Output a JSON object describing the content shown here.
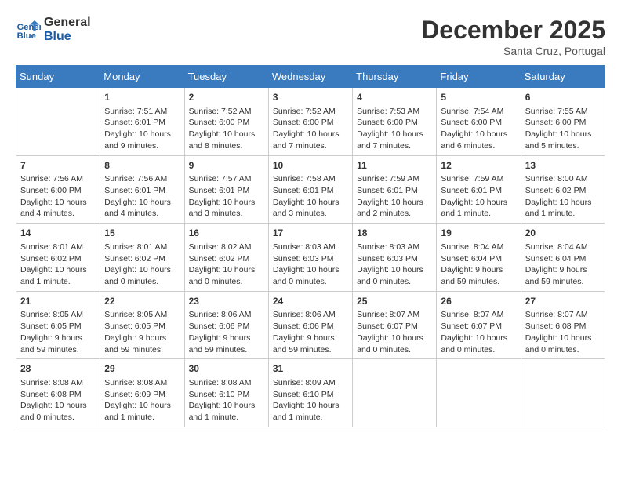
{
  "header": {
    "logo_line1": "General",
    "logo_line2": "Blue",
    "month_year": "December 2025",
    "location": "Santa Cruz, Portugal"
  },
  "days_of_week": [
    "Sunday",
    "Monday",
    "Tuesday",
    "Wednesday",
    "Thursday",
    "Friday",
    "Saturday"
  ],
  "weeks": [
    [
      {
        "day": "",
        "info": ""
      },
      {
        "day": "1",
        "info": "Sunrise: 7:51 AM\nSunset: 6:01 PM\nDaylight: 10 hours\nand 9 minutes."
      },
      {
        "day": "2",
        "info": "Sunrise: 7:52 AM\nSunset: 6:00 PM\nDaylight: 10 hours\nand 8 minutes."
      },
      {
        "day": "3",
        "info": "Sunrise: 7:52 AM\nSunset: 6:00 PM\nDaylight: 10 hours\nand 7 minutes."
      },
      {
        "day": "4",
        "info": "Sunrise: 7:53 AM\nSunset: 6:00 PM\nDaylight: 10 hours\nand 7 minutes."
      },
      {
        "day": "5",
        "info": "Sunrise: 7:54 AM\nSunset: 6:00 PM\nDaylight: 10 hours\nand 6 minutes."
      },
      {
        "day": "6",
        "info": "Sunrise: 7:55 AM\nSunset: 6:00 PM\nDaylight: 10 hours\nand 5 minutes."
      }
    ],
    [
      {
        "day": "7",
        "info": "Sunrise: 7:56 AM\nSunset: 6:00 PM\nDaylight: 10 hours\nand 4 minutes."
      },
      {
        "day": "8",
        "info": "Sunrise: 7:56 AM\nSunset: 6:01 PM\nDaylight: 10 hours\nand 4 minutes."
      },
      {
        "day": "9",
        "info": "Sunrise: 7:57 AM\nSunset: 6:01 PM\nDaylight: 10 hours\nand 3 minutes."
      },
      {
        "day": "10",
        "info": "Sunrise: 7:58 AM\nSunset: 6:01 PM\nDaylight: 10 hours\nand 3 minutes."
      },
      {
        "day": "11",
        "info": "Sunrise: 7:59 AM\nSunset: 6:01 PM\nDaylight: 10 hours\nand 2 minutes."
      },
      {
        "day": "12",
        "info": "Sunrise: 7:59 AM\nSunset: 6:01 PM\nDaylight: 10 hours\nand 1 minute."
      },
      {
        "day": "13",
        "info": "Sunrise: 8:00 AM\nSunset: 6:02 PM\nDaylight: 10 hours\nand 1 minute."
      }
    ],
    [
      {
        "day": "14",
        "info": "Sunrise: 8:01 AM\nSunset: 6:02 PM\nDaylight: 10 hours\nand 1 minute."
      },
      {
        "day": "15",
        "info": "Sunrise: 8:01 AM\nSunset: 6:02 PM\nDaylight: 10 hours\nand 0 minutes."
      },
      {
        "day": "16",
        "info": "Sunrise: 8:02 AM\nSunset: 6:02 PM\nDaylight: 10 hours\nand 0 minutes."
      },
      {
        "day": "17",
        "info": "Sunrise: 8:03 AM\nSunset: 6:03 PM\nDaylight: 10 hours\nand 0 minutes."
      },
      {
        "day": "18",
        "info": "Sunrise: 8:03 AM\nSunset: 6:03 PM\nDaylight: 10 hours\nand 0 minutes."
      },
      {
        "day": "19",
        "info": "Sunrise: 8:04 AM\nSunset: 6:04 PM\nDaylight: 9 hours\nand 59 minutes."
      },
      {
        "day": "20",
        "info": "Sunrise: 8:04 AM\nSunset: 6:04 PM\nDaylight: 9 hours\nand 59 minutes."
      }
    ],
    [
      {
        "day": "21",
        "info": "Sunrise: 8:05 AM\nSunset: 6:05 PM\nDaylight: 9 hours\nand 59 minutes."
      },
      {
        "day": "22",
        "info": "Sunrise: 8:05 AM\nSunset: 6:05 PM\nDaylight: 9 hours\nand 59 minutes."
      },
      {
        "day": "23",
        "info": "Sunrise: 8:06 AM\nSunset: 6:06 PM\nDaylight: 9 hours\nand 59 minutes."
      },
      {
        "day": "24",
        "info": "Sunrise: 8:06 AM\nSunset: 6:06 PM\nDaylight: 9 hours\nand 59 minutes."
      },
      {
        "day": "25",
        "info": "Sunrise: 8:07 AM\nSunset: 6:07 PM\nDaylight: 10 hours\nand 0 minutes."
      },
      {
        "day": "26",
        "info": "Sunrise: 8:07 AM\nSunset: 6:07 PM\nDaylight: 10 hours\nand 0 minutes."
      },
      {
        "day": "27",
        "info": "Sunrise: 8:07 AM\nSunset: 6:08 PM\nDaylight: 10 hours\nand 0 minutes."
      }
    ],
    [
      {
        "day": "28",
        "info": "Sunrise: 8:08 AM\nSunset: 6:08 PM\nDaylight: 10 hours\nand 0 minutes."
      },
      {
        "day": "29",
        "info": "Sunrise: 8:08 AM\nSunset: 6:09 PM\nDaylight: 10 hours\nand 1 minute."
      },
      {
        "day": "30",
        "info": "Sunrise: 8:08 AM\nSunset: 6:10 PM\nDaylight: 10 hours\nand 1 minute."
      },
      {
        "day": "31",
        "info": "Sunrise: 8:09 AM\nSunset: 6:10 PM\nDaylight: 10 hours\nand 1 minute."
      },
      {
        "day": "",
        "info": ""
      },
      {
        "day": "",
        "info": ""
      },
      {
        "day": "",
        "info": ""
      }
    ]
  ]
}
